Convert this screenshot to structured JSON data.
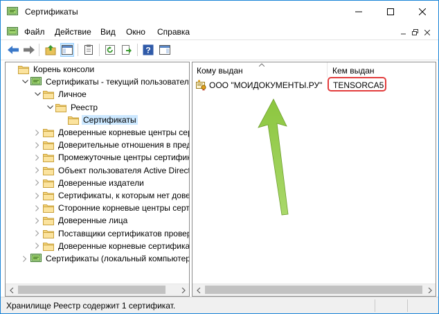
{
  "window": {
    "title": "Сертификаты"
  },
  "menu": {
    "items": [
      "Файл",
      "Действие",
      "Вид",
      "Окно",
      "Справка"
    ]
  },
  "toolbar": {
    "buttons": [
      "back-arrow-icon",
      "forward-arrow-icon",
      "up-folder-icon",
      "show-hide-tree-icon",
      "properties-icon",
      "refresh-icon",
      "export-list-icon",
      "help-icon",
      "action-pane-icon"
    ]
  },
  "tree": {
    "nodes": [
      {
        "label": "Корень консоли",
        "icon": "folder-icon"
      },
      {
        "label": "Сертификаты - текущий пользователь",
        "icon": "cert-store-icon"
      },
      {
        "label": "Личное",
        "icon": "folder-icon"
      },
      {
        "label": "Реестр",
        "icon": "folder-icon"
      },
      {
        "label": "Сертификаты",
        "icon": "folder-icon"
      },
      {
        "label": "Доверенные корневые центры серти",
        "icon": "folder-icon"
      },
      {
        "label": "Доверительные отношения в предп",
        "icon": "folder-icon"
      },
      {
        "label": "Промежуточные центры сертифика",
        "icon": "folder-icon"
      },
      {
        "label": "Объект пользователя Active Director",
        "icon": "folder-icon"
      },
      {
        "label": "Доверенные издатели",
        "icon": "folder-icon"
      },
      {
        "label": "Сертификаты, к которым нет довери",
        "icon": "folder-icon"
      },
      {
        "label": "Сторонние корневые центры сертис",
        "icon": "folder-icon"
      },
      {
        "label": "Доверенные лица",
        "icon": "folder-icon"
      },
      {
        "label": "Поставщики сертификатов проверк",
        "icon": "folder-icon"
      },
      {
        "label": "Доверенные корневые сертификаты",
        "icon": "folder-icon"
      },
      {
        "label": "Сертификаты (локальный компьютер)",
        "icon": "cert-store-icon"
      }
    ]
  },
  "list": {
    "columns": [
      "Кому выдан",
      "Кем выдан"
    ],
    "rows": [
      {
        "issued_to": "ООО \"МОИДОКУМЕНТЫ.РУ\"",
        "issued_by": "TENSORCA5"
      }
    ]
  },
  "status": {
    "text": "Хранилище Реестр содержит 1 сертификат."
  },
  "colors": {
    "selection": "#cce8ff",
    "highlight_box": "#e23c3c",
    "arrow": "#8cc63f",
    "border": "#1883d7"
  }
}
